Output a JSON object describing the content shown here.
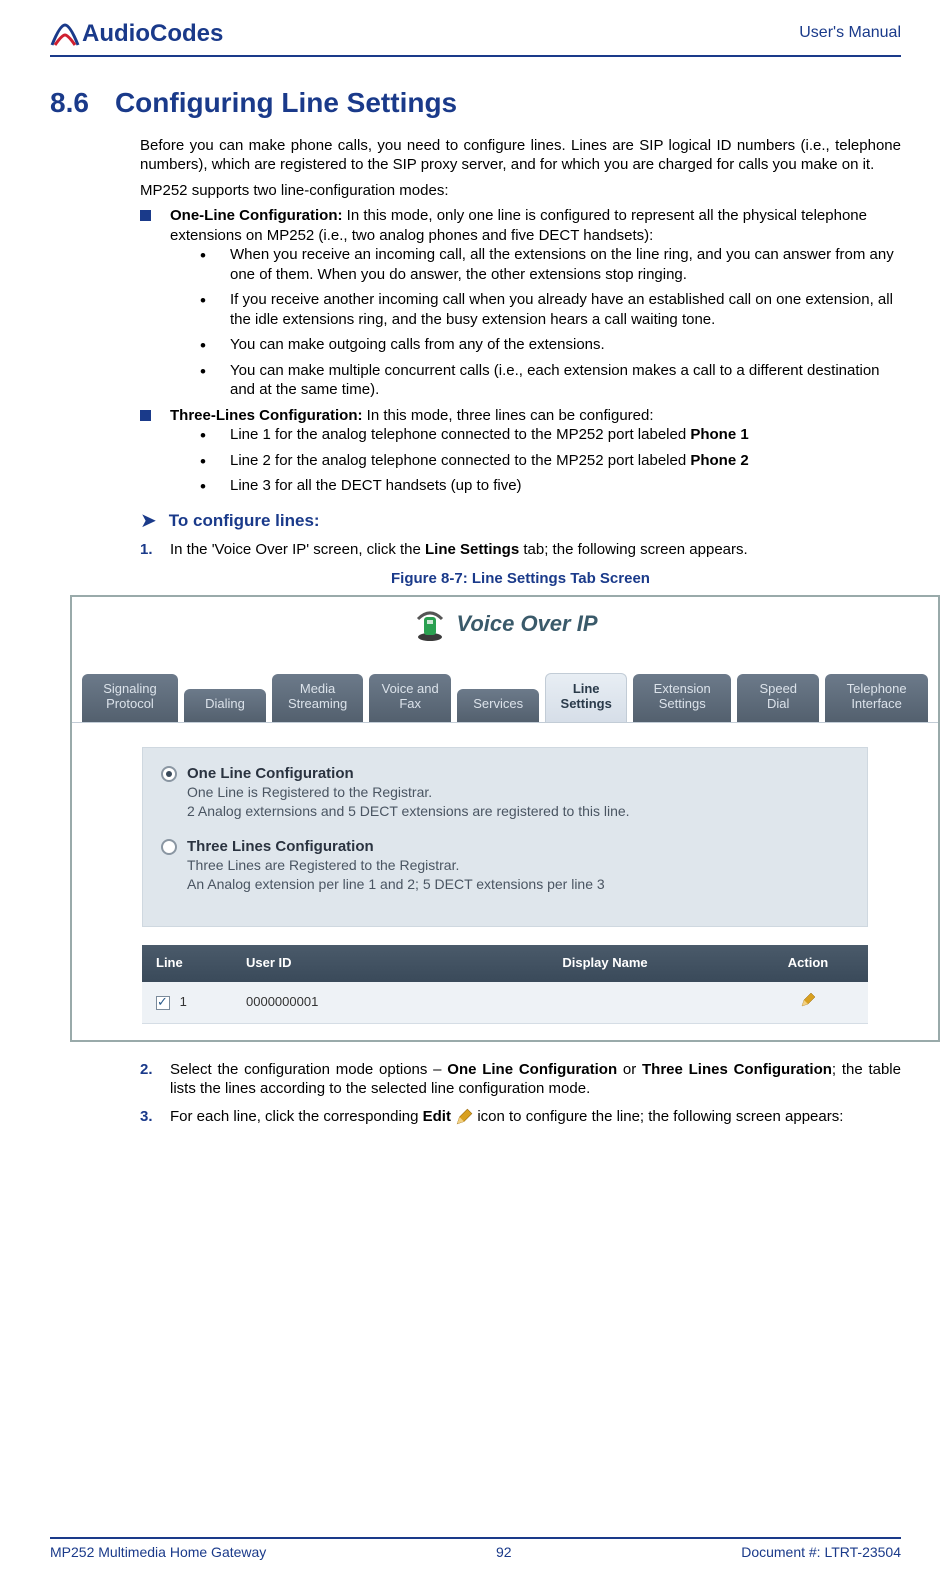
{
  "header": {
    "brand": "AudioCodes",
    "right": "User's Manual"
  },
  "section": {
    "number": "8.6",
    "title": "Configuring Line Settings"
  },
  "intro": {
    "p1": "Before you can make phone calls, you need to configure lines. Lines are SIP logical ID numbers (i.e., telephone numbers), which are registered to the SIP proxy server, and for which you are charged for calls you make on it.",
    "p2": "MP252 supports two line-configuration modes:"
  },
  "modes": {
    "one_line": {
      "title": "One-Line Configuration:",
      "desc": " In this mode, only one line is configured to represent all the physical telephone extensions on MP252 (i.e., two analog phones and five DECT handsets):",
      "bullets": [
        "When you receive an incoming call, all the extensions on the line ring, and you can answer from any one of them. When you do answer, the other extensions stop ringing.",
        "If you receive another incoming call when you already have an established call on one extension, all the idle extensions ring, and the busy extension hears a call waiting tone.",
        "You can make outgoing calls from any of the extensions.",
        "You can make multiple concurrent calls (i.e., each extension makes a call to a different destination and at the same time)."
      ]
    },
    "three_lines": {
      "title": "Three-Lines Configuration:",
      "desc": " In this mode, three lines can be configured:",
      "bullets_pre": [
        "Line 1 for the analog telephone connected to the MP252 port labeled ",
        "Line 2 for the analog telephone connected to the MP252 port labeled ",
        "Line 3 for all the DECT handsets (up to five)"
      ],
      "bullets_bold": [
        "Phone 1",
        "Phone 2",
        ""
      ]
    }
  },
  "procedure": {
    "title": "To configure lines:"
  },
  "steps": {
    "s1_pre": "In the 'Voice Over IP' screen, click the ",
    "s1_bold": "Line Settings",
    "s1_post": " tab; the following screen appears.",
    "s2_pre": "Select the configuration mode options – ",
    "s2_b1": "One Line Configuration",
    "s2_mid": " or ",
    "s2_b2": "Three Lines Configuration",
    "s2_post": "; the table lists the lines according to the selected line configuration mode.",
    "s3_pre": "For each line, click the corresponding ",
    "s3_bold": "Edit",
    "s3_post": " icon to configure the line; the following screen appears:"
  },
  "figure": {
    "caption": "Figure 8-7: Line Settings Tab Screen"
  },
  "screenshot": {
    "title": "Voice Over IP",
    "tabs": [
      "Signaling Protocol",
      "Dialing",
      "Media Streaming",
      "Voice and Fax",
      "Services",
      "Line Settings",
      "Extension Settings",
      "Speed Dial",
      "Telephone Interface"
    ],
    "active_tab_index": 5,
    "options": {
      "one": {
        "title": "One Line Configuration",
        "desc": "One Line is Registered to the Registrar.\n2 Analog externsions and 5 DECT extensions are registered to this line."
      },
      "three": {
        "title": "Three Lines Configuration",
        "desc": "Three Lines are Registered to the Registrar.\nAn Analog extension per line 1 and 2; 5 DECT extensions per line 3"
      }
    },
    "table": {
      "headers": {
        "line": "Line",
        "user": "User ID",
        "disp": "Display Name",
        "act": "Action"
      },
      "rows": [
        {
          "line": "1",
          "user": "0000000001",
          "disp": "",
          "checked": true
        }
      ]
    }
  },
  "footer": {
    "left": "MP252 Multimedia Home Gateway",
    "center": "92",
    "right": "Document #: LTRT-23504"
  }
}
